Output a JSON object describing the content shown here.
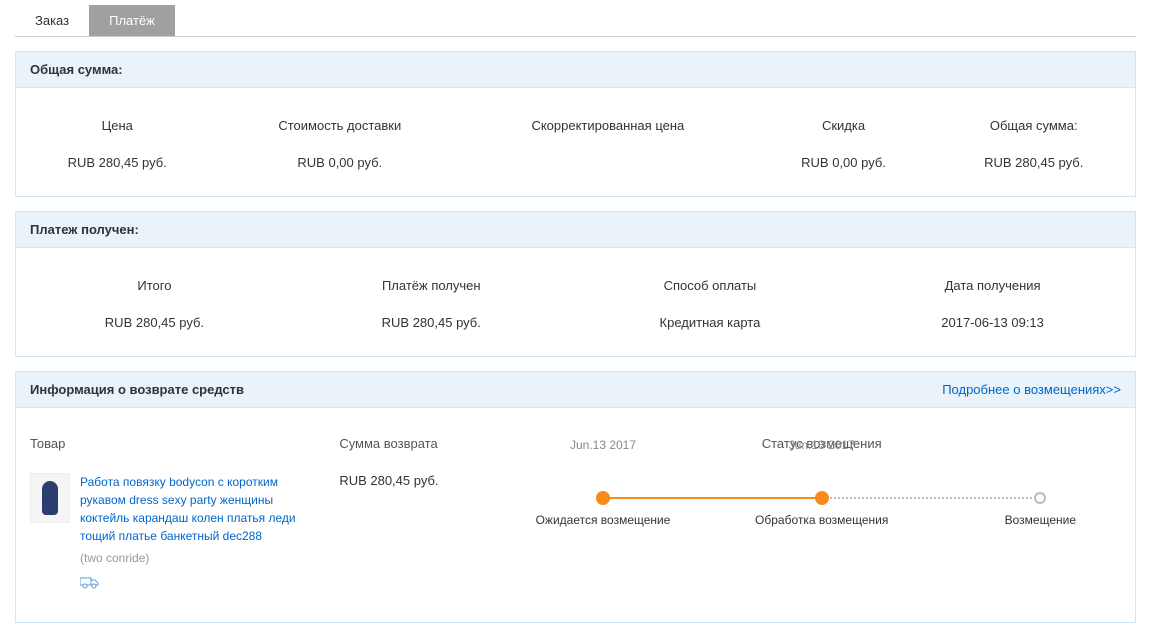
{
  "tabs": {
    "order": "Заказ",
    "payment": "Платёж"
  },
  "total_panel": {
    "title": "Общая сумма:",
    "headers": {
      "price": "Цена",
      "shipping": "Стоимость доставки",
      "adjusted": "Скорректированная цена",
      "discount": "Скидка",
      "total": "Общая сумма:"
    },
    "values": {
      "price": "RUB 280,45 руб.",
      "shipping": "RUB 0,00 руб.",
      "adjusted": "",
      "discount": "RUB 0,00 руб.",
      "total": "RUB 280,45 руб."
    }
  },
  "received_panel": {
    "title": "Платеж получен:",
    "headers": {
      "subtotal": "Итого",
      "received": "Платёж получен",
      "method": "Способ оплаты",
      "date": "Дата получения"
    },
    "values": {
      "subtotal": "RUB 280,45 руб.",
      "received": "RUB 280,45 руб.",
      "method": "Кредитная карта",
      "date": "2017-06-13 09:13"
    }
  },
  "refund_panel": {
    "title": "Информация о возврате средств",
    "more_link": "Подробнее о возмещениях>>",
    "headers": {
      "product": "Товар",
      "amount": "Сумма возврата",
      "status": "Статус возмещения"
    },
    "product": {
      "title": "Работа повязку bodycon с коротким рукавом dress sexy party женщины коктейль карандаш колен платья леди тощий платье банкетный dec288",
      "sku": "(two conride)"
    },
    "amount": "RUB 280,45 руб.",
    "timeline": {
      "steps": {
        "s1": "Ожидается возмещение",
        "s2": "Обработка возмещения",
        "s3": "Возмещение"
      },
      "dates": {
        "d1": "Jun.13 2017",
        "d2": "Jun.13 2017"
      }
    }
  }
}
